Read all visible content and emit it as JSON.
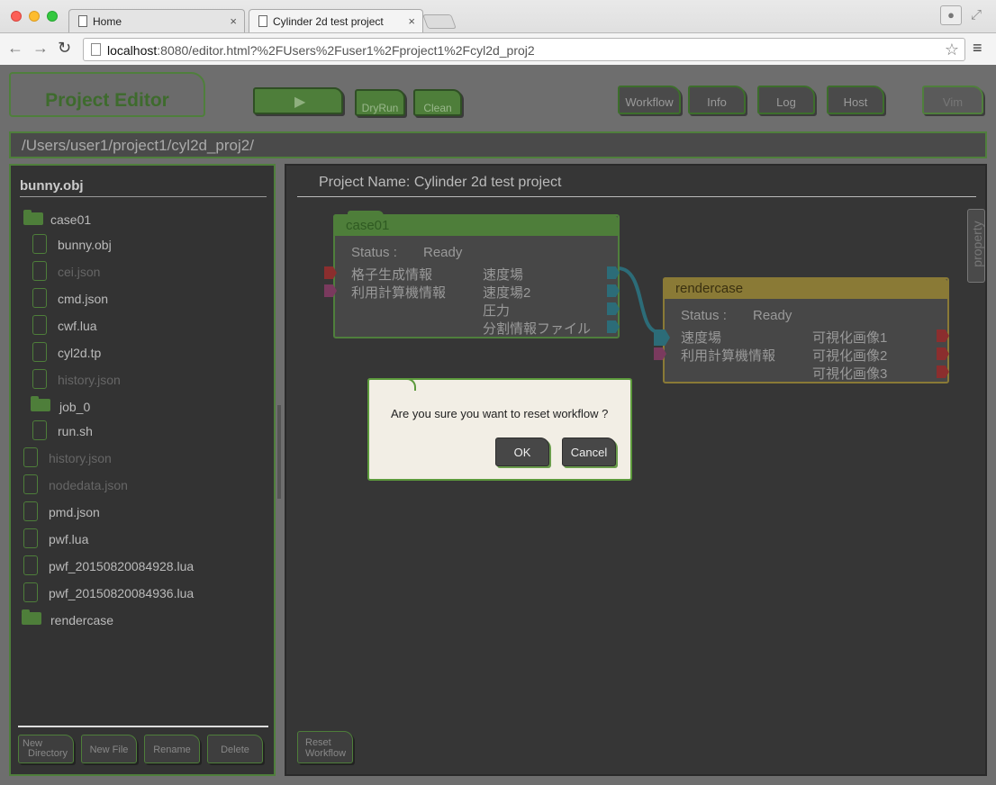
{
  "browser": {
    "tabs": [
      {
        "label": "Home"
      },
      {
        "label": "Cylinder 2d test project"
      }
    ],
    "address_host": "localhost",
    "address_rest": ":8080/editor.html?%2FUsers%2Fuser1%2Fproject1%2Fcyl2d_proj2",
    "tab_close": "×"
  },
  "toolbar": {
    "title": "Project Editor",
    "run_icon": "▶",
    "dryrun": "DryRun",
    "clean": "Clean",
    "workflow": "Workflow",
    "info": "Info",
    "log": "Log",
    "host": "Host",
    "vim": "Vim"
  },
  "path": "/Users/user1/project1/cyl2d_proj2/",
  "file_panel": {
    "title": "bunny.obj",
    "items": [
      {
        "label": "case01",
        "type": "folder",
        "dim": false
      },
      {
        "label": "bunny.obj",
        "type": "file",
        "dim": false
      },
      {
        "label": "cei.json",
        "type": "file",
        "dim": true
      },
      {
        "label": "cmd.json",
        "type": "file",
        "dim": false
      },
      {
        "label": "cwf.lua",
        "type": "file",
        "dim": false
      },
      {
        "label": "cyl2d.tp",
        "type": "file",
        "dim": false
      },
      {
        "label": "history.json",
        "type": "file",
        "dim": true
      },
      {
        "label": "job_0",
        "type": "folder",
        "dim": false
      },
      {
        "label": "run.sh",
        "type": "file",
        "dim": false
      },
      {
        "label": "history.json",
        "type": "file",
        "dim": true
      },
      {
        "label": "nodedata.json",
        "type": "file",
        "dim": true
      },
      {
        "label": "pmd.json",
        "type": "file",
        "dim": false
      },
      {
        "label": "pwf.lua",
        "type": "file",
        "dim": false
      },
      {
        "label": "pwf_20150820084928.lua",
        "type": "file",
        "dim": false
      },
      {
        "label": "pwf_20150820084936.lua",
        "type": "file",
        "dim": false
      },
      {
        "label": "rendercase",
        "type": "folder",
        "dim": false
      }
    ],
    "buttons": {
      "new_directory_1": "New",
      "new_directory_2": "Directory",
      "new_file": "New File",
      "rename": "Rename",
      "delete": "Delete"
    }
  },
  "workflow": {
    "project_name": "Project Name: Cylinder 2d test project",
    "property": "property",
    "reset_1": "Reset",
    "reset_2": "Workflow",
    "node_case01": {
      "title": "case01",
      "status_label": "Status :",
      "status": "Ready",
      "inputs": [
        "格子生成情報",
        "利用計算機情報"
      ],
      "outputs": [
        "速度場",
        "速度場2",
        "圧力",
        "分割情報ファイル"
      ],
      "head_color": "#4e7e3a"
    },
    "node_render": {
      "title": "rendercase",
      "status_label": "Status :",
      "status": "Ready",
      "inputs": [
        "速度場",
        "利用計算機情報"
      ],
      "outputs": [
        "可視化画像1",
        "可視化画像2",
        "可視化画像3"
      ],
      "head_color": "#8a7a36"
    }
  },
  "dialog": {
    "message": "Are you sure you want to reset workflow ?",
    "ok": "OK",
    "cancel": "Cancel"
  }
}
